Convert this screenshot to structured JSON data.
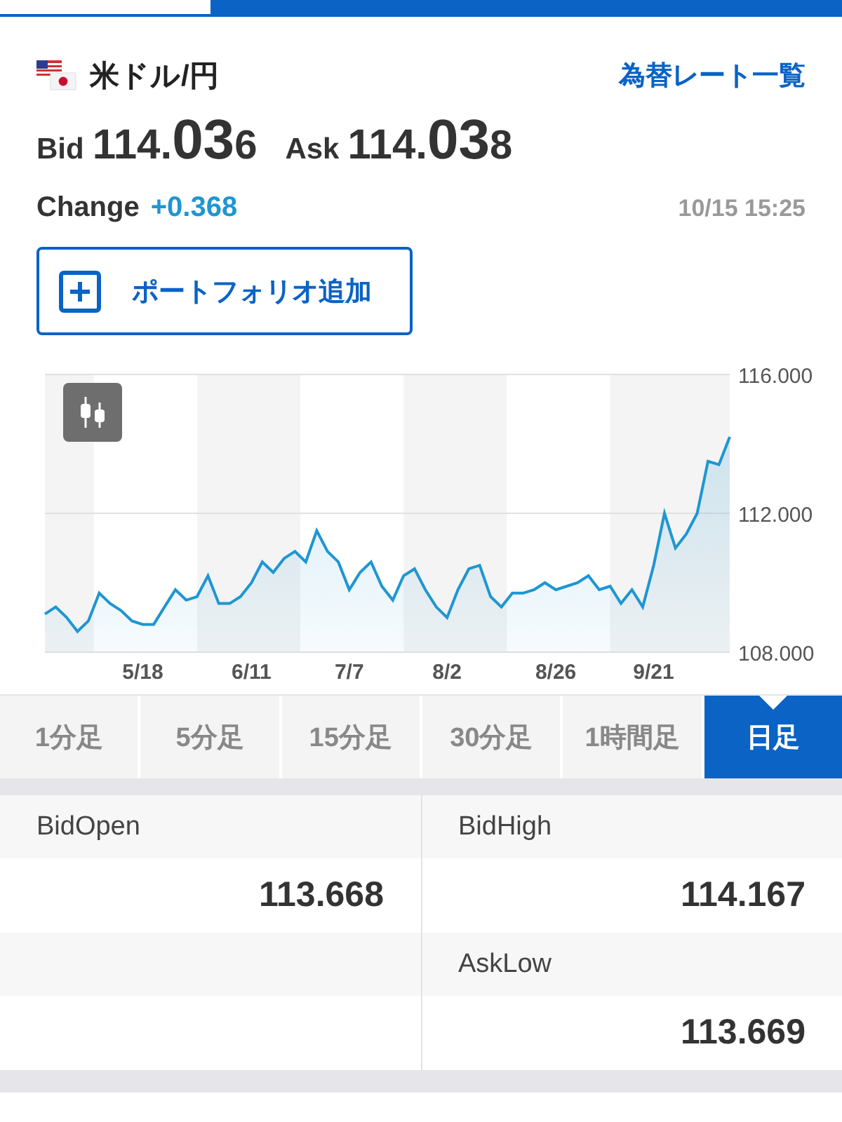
{
  "pair": {
    "name": "米ドル/円",
    "link": "為替レート一覧"
  },
  "quotes": [
    {
      "label": "Bid",
      "prefix": "114.",
      "pips": "03",
      "suffix": "6"
    },
    {
      "label": "Ask",
      "prefix": "114.",
      "pips": "03",
      "suffix": "8"
    }
  ],
  "change": {
    "label": "Change",
    "value": "+0.368",
    "time": "10/15 15:25"
  },
  "portfolio_button": {
    "label": "ポートフォリオ追加"
  },
  "chart": {
    "chart_data": {
      "type": "area",
      "categories": [
        null,
        null,
        null,
        null,
        null,
        null,
        null,
        null,
        null,
        "5/18",
        null,
        null,
        null,
        null,
        null,
        null,
        null,
        null,
        null,
        "6/11",
        null,
        null,
        null,
        null,
        null,
        null,
        null,
        null,
        "7/7",
        null,
        null,
        null,
        null,
        null,
        null,
        null,
        null,
        "8/2",
        null,
        null,
        null,
        null,
        null,
        null,
        null,
        null,
        null,
        "8/26",
        null,
        null,
        null,
        null,
        null,
        null,
        null,
        null,
        "9/21",
        null,
        null,
        null,
        null,
        null,
        null,
        null
      ],
      "series": [
        {
          "color": "#1e96d2",
          "values": [
            109.1,
            109.3,
            109.0,
            108.6,
            108.9,
            109.7,
            109.4,
            109.2,
            108.9,
            108.8,
            108.8,
            109.3,
            109.8,
            109.5,
            109.6,
            110.2,
            109.4,
            109.4,
            109.6,
            110.0,
            110.6,
            110.3,
            110.7,
            110.9,
            110.6,
            111.5,
            110.9,
            110.6,
            109.8,
            110.3,
            110.6,
            109.9,
            109.5,
            110.2,
            110.4,
            109.8,
            109.3,
            109.0,
            109.8,
            110.4,
            110.5,
            109.6,
            109.3,
            109.7,
            109.7,
            109.8,
            110.0,
            109.8,
            109.9,
            110.0,
            110.2,
            109.8,
            109.9,
            109.4,
            109.8,
            109.3,
            110.5,
            112.0,
            111.0,
            111.4,
            112.0,
            113.5,
            113.4,
            114.2
          ]
        }
      ],
      "ylim": [
        108,
        116
      ],
      "yticks": [
        {
          "value": 116,
          "label": "116.000"
        },
        {
          "value": 112,
          "label": "112.000"
        },
        {
          "value": 108,
          "label": "108.000"
        }
      ]
    }
  },
  "intervals": [
    {
      "label": "1分足",
      "selected": false
    },
    {
      "label": "5分足",
      "selected": false
    },
    {
      "label": "15分足",
      "selected": false
    },
    {
      "label": "30分足",
      "selected": false
    },
    {
      "label": "1時間足",
      "selected": false
    },
    {
      "label": "日足",
      "selected": true
    }
  ],
  "stats": {
    "left": [
      {
        "label": "BidOpen",
        "value": "113.668"
      }
    ],
    "right": [
      {
        "label": "BidHigh",
        "value": "114.167"
      },
      {
        "label": "AskLow",
        "value": "113.669"
      }
    ]
  }
}
